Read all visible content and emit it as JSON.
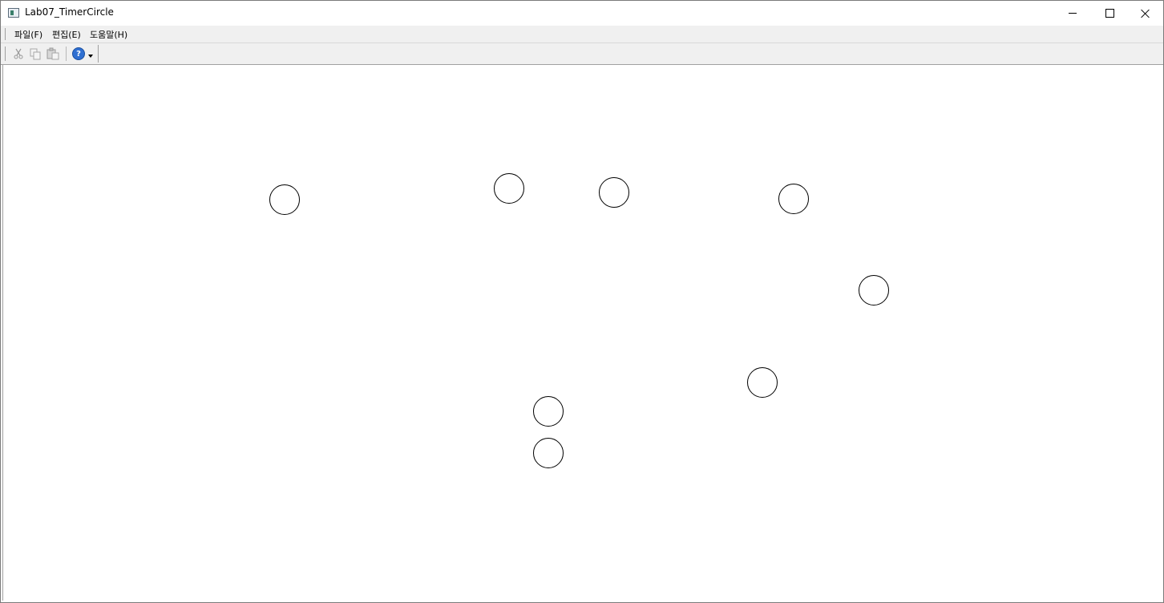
{
  "window": {
    "title": "Lab07_TimerCircle"
  },
  "menu": {
    "file": "파일(F)",
    "edit": "편집(E)",
    "help": "도움말(H)"
  },
  "toolbar": {
    "buttons": [
      "cut-icon",
      "copy-icon",
      "paste-icon",
      "help-icon"
    ],
    "help_glyph": "?"
  },
  "colors": {
    "circle_stroke": "#000000",
    "background": "#ffffff",
    "chrome": "#f0f0f0"
  },
  "circles": {
    "count": 8
  }
}
